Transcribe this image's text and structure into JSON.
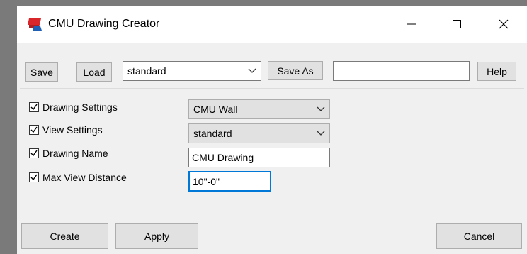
{
  "window": {
    "title": "CMU Drawing Creator",
    "accent_color": "#0078d7",
    "icons": {
      "app": "cmu-app-icon",
      "minimize": "minimize-icon",
      "maximize": "maximize-icon",
      "close": "close-icon"
    }
  },
  "toolbar": {
    "save_label": "Save",
    "load_label": "Load",
    "preset_value": "standard",
    "save_as_label": "Save As",
    "save_as_value": "",
    "help_label": "Help"
  },
  "settings": [
    {
      "label": "Drawing Settings",
      "checked": true,
      "control": "dropdown",
      "value": "CMU Wall"
    },
    {
      "label": "View Settings",
      "checked": true,
      "control": "dropdown",
      "value": "standard"
    },
    {
      "label": "Drawing Name",
      "checked": true,
      "control": "text",
      "value": "CMU Drawing"
    },
    {
      "label": "Max View Distance",
      "checked": true,
      "control": "text",
      "value": "10\"-0\""
    }
  ],
  "footer": {
    "create_label": "Create",
    "apply_label": "Apply",
    "cancel_label": "Cancel"
  }
}
